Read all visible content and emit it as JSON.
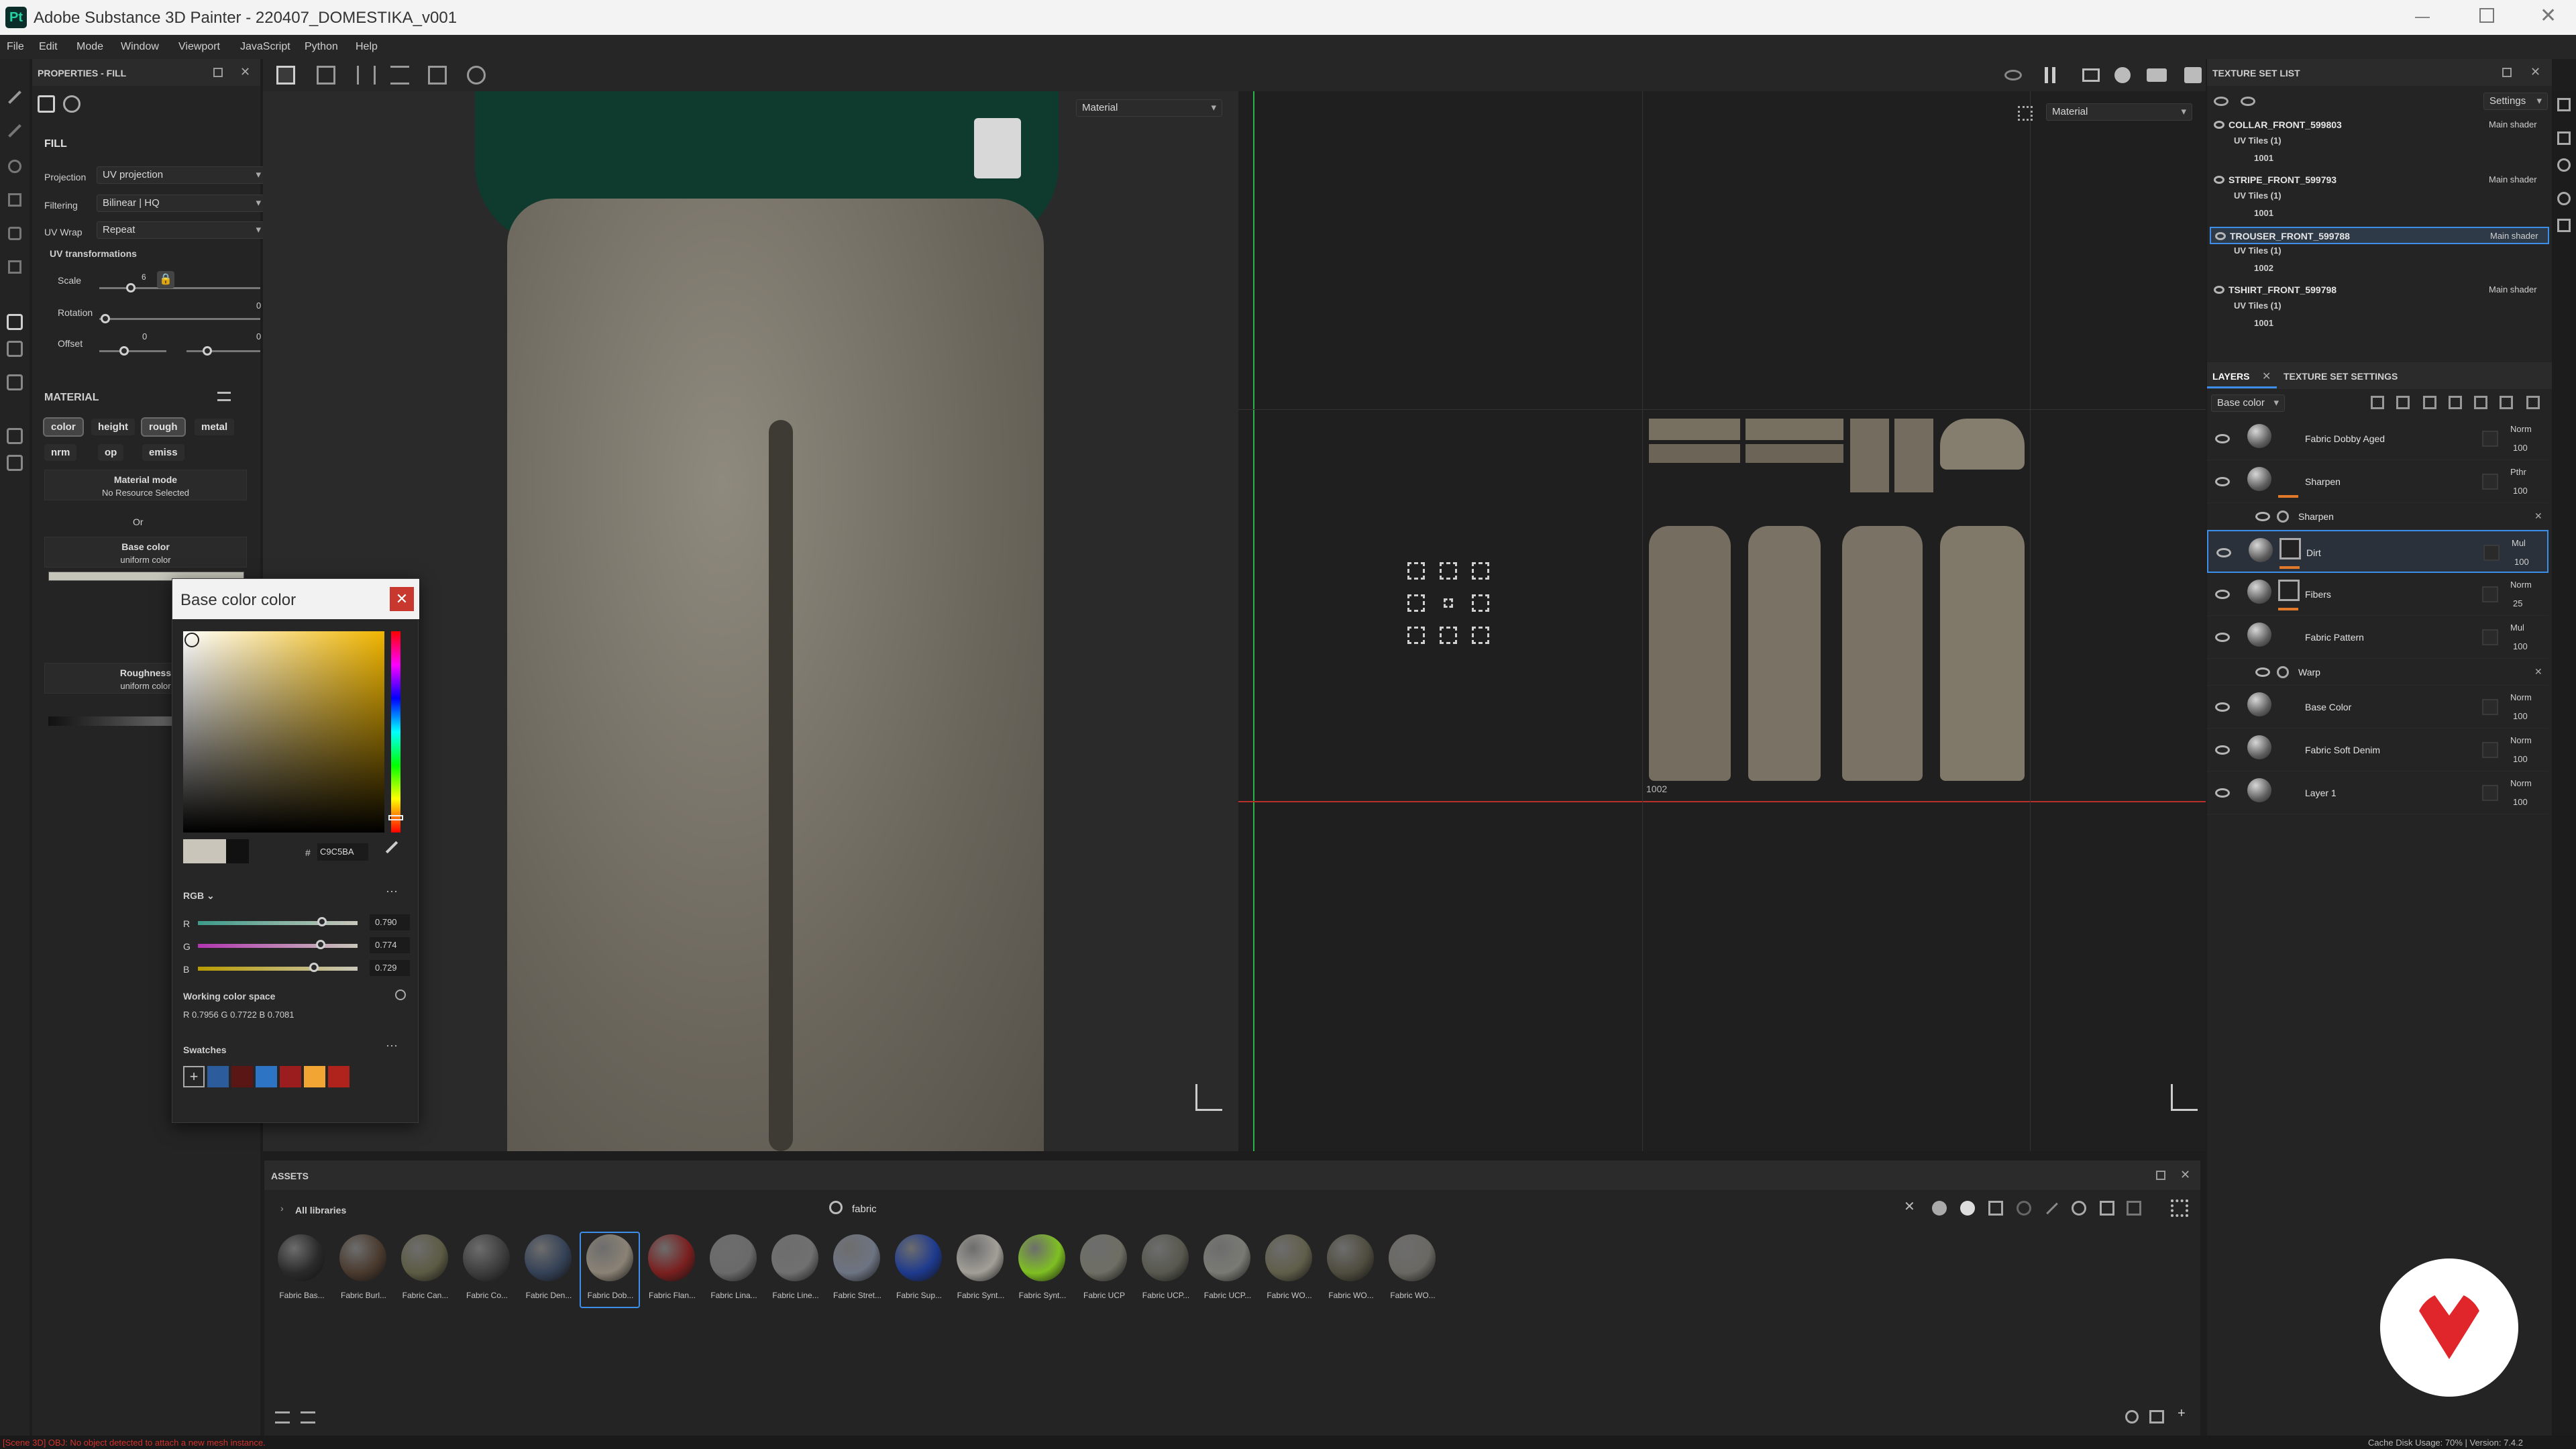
{
  "window": {
    "title": "Adobe Substance 3D Painter - 220407_DOMESTIKA_v001"
  },
  "menu": [
    "File",
    "Edit",
    "Mode",
    "Window",
    "Viewport",
    "JavaScript",
    "Python",
    "Help"
  ],
  "properties": {
    "title": "PROPERTIES - FILL",
    "section": "FILL",
    "projection": {
      "label": "Projection",
      "value": "UV projection"
    },
    "filtering": {
      "label": "Filtering",
      "value": "Bilinear | HQ"
    },
    "uv_wrap": {
      "label": "UV Wrap",
      "value": "Repeat"
    },
    "uv_transform": {
      "title": "UV transformations",
      "scale_label": "Scale",
      "scale_value": "6",
      "rotation_label": "Rotation",
      "rotation_value": "0",
      "offset_label": "Offset",
      "offset_u": "0",
      "offset_v": "0"
    },
    "material": {
      "title": "MATERIAL",
      "channels": [
        "color",
        "height",
        "rough",
        "metal",
        "nrm",
        "op",
        "emiss"
      ],
      "mode_title": "Material mode",
      "mode_value": "No Resource Selected",
      "or": "Or",
      "base_color": {
        "title": "Base color",
        "sub": "uniform color"
      },
      "roughness": {
        "title": "Roughness",
        "sub": "uniform color"
      }
    }
  },
  "viewport3d": {
    "channel": "Material"
  },
  "viewport2d": {
    "channel": "Material",
    "tile_number": "1002"
  },
  "color_picker": {
    "title": "Base color color",
    "hex_prefix": "#",
    "hex": "C9C5BA",
    "model": "RGB ⌄",
    "channels": [
      {
        "label": "R",
        "value": "0.790"
      },
      {
        "label": "G",
        "value": "0.774"
      },
      {
        "label": "B",
        "value": "0.729"
      }
    ],
    "working_space_label": "Working color space",
    "working_space_values": "R 0.7956   G 0.7722   B 0.7081",
    "swatches_label": "Swatches"
  },
  "texture_sets": {
    "title": "TEXTURE SET LIST",
    "settings": "Settings",
    "items": [
      {
        "name": "COLLAR_FRONT_599803",
        "shader": "Main shader",
        "uv": "UV Tiles (1)",
        "tile": "1001",
        "selected": false
      },
      {
        "name": "STRIPE_FRONT_599793",
        "shader": "Main shader",
        "uv": "UV Tiles (1)",
        "tile": "1001",
        "selected": false
      },
      {
        "name": "TROUSER_FRONT_599788",
        "shader": "Main shader",
        "uv": "UV Tiles (1)",
        "tile": "1002",
        "selected": true
      },
      {
        "name": "TSHIRT_FRONT_599798",
        "shader": "Main shader",
        "uv": "UV Tiles (1)",
        "tile": "1001",
        "selected": false
      }
    ]
  },
  "layers": {
    "tabs": [
      "LAYERS",
      "TEXTURE SET SETTINGS"
    ],
    "channel": "Base color",
    "items": [
      {
        "name": "Fabric Dobby Aged",
        "blend": "Norm",
        "opacity": "100",
        "kind": "folder",
        "indent": 0,
        "bar": "",
        "selected": false
      },
      {
        "name": "Sharpen",
        "blend": "Pthr",
        "opacity": "100",
        "kind": "paint",
        "indent": 0,
        "bar": "#e07a2a",
        "selected": false
      },
      {
        "name": "Sharpen",
        "blend": "",
        "opacity": "",
        "kind": "effect",
        "indent": 1,
        "bar": "",
        "selected": false
      },
      {
        "name": "Dirt",
        "blend": "Mul",
        "opacity": "100",
        "kind": "fill",
        "indent": 0,
        "bar": "#e07a2a",
        "selected": true
      },
      {
        "name": "Fibers",
        "blend": "Norm",
        "opacity": "25",
        "kind": "fill",
        "indent": 0,
        "bar": "#e07a2a",
        "selected": false
      },
      {
        "name": "Fabric Pattern",
        "blend": "Mul",
        "opacity": "100",
        "kind": "fill",
        "indent": 0,
        "bar": "",
        "selected": false
      },
      {
        "name": "Warp",
        "blend": "",
        "opacity": "",
        "kind": "effect",
        "indent": 1,
        "bar": "",
        "selected": false
      },
      {
        "name": "Base Color",
        "blend": "Norm",
        "opacity": "100",
        "kind": "fill",
        "indent": 0,
        "bar": "",
        "selected": false
      },
      {
        "name": "Fabric Soft Denim",
        "blend": "Norm",
        "opacity": "100",
        "kind": "fill",
        "indent": 0,
        "bar": "",
        "selected": false
      },
      {
        "name": "Layer 1",
        "blend": "Norm",
        "opacity": "100",
        "kind": "paint",
        "indent": 0,
        "bar": "",
        "selected": false
      }
    ]
  },
  "assets": {
    "title": "ASSETS",
    "library": "All libraries",
    "search": "fabric",
    "items": [
      {
        "label": "Fabric Bas...",
        "color": "#2a2a2a",
        "selected": false
      },
      {
        "label": "Fabric Burl...",
        "color": "#4a3a2e",
        "selected": false
      },
      {
        "label": "Fabric Can...",
        "color": "#5c5b44",
        "selected": false
      },
      {
        "label": "Fabric Co...",
        "color": "#3d3d3d",
        "selected": false
      },
      {
        "label": "Fabric Den...",
        "color": "#344156",
        "selected": false
      },
      {
        "label": "Fabric Dob...",
        "color": "#8a8275",
        "selected": true
      },
      {
        "label": "Fabric Flan...",
        "color": "#7a1f1f",
        "selected": false
      },
      {
        "label": "Fabric Lina...",
        "color": "#6a6a6a",
        "selected": false
      },
      {
        "label": "Fabric Line...",
        "color": "#707070",
        "selected": false
      },
      {
        "label": "Fabric Stret...",
        "color": "#6d7482",
        "selected": false
      },
      {
        "label": "Fabric Sup...",
        "color": "#1e3a8e",
        "selected": false
      },
      {
        "label": "Fabric Synt...",
        "color": "#a29f98",
        "selected": false
      },
      {
        "label": "Fabric Synt...",
        "color": "#7fbf23",
        "selected": false
      },
      {
        "label": "Fabric UCP",
        "color": "#6e6e64",
        "selected": false
      },
      {
        "label": "Fabric UCP...",
        "color": "#58584f",
        "selected": false
      },
      {
        "label": "Fabric UCP...",
        "color": "#7a7a74",
        "selected": false
      },
      {
        "label": "Fabric WO...",
        "color": "#605e4a",
        "selected": false
      },
      {
        "label": "Fabric WO...",
        "color": "#4f4d3f",
        "selected": false
      },
      {
        "label": "Fabric WO...",
        "color": "#6a6862",
        "selected": false
      }
    ]
  },
  "status": {
    "message": "[Scene 3D] OBJ: No object detected to attach a new mesh instance.",
    "right": "Cache Disk Usage:  70% | Version: 7.4.2"
  }
}
